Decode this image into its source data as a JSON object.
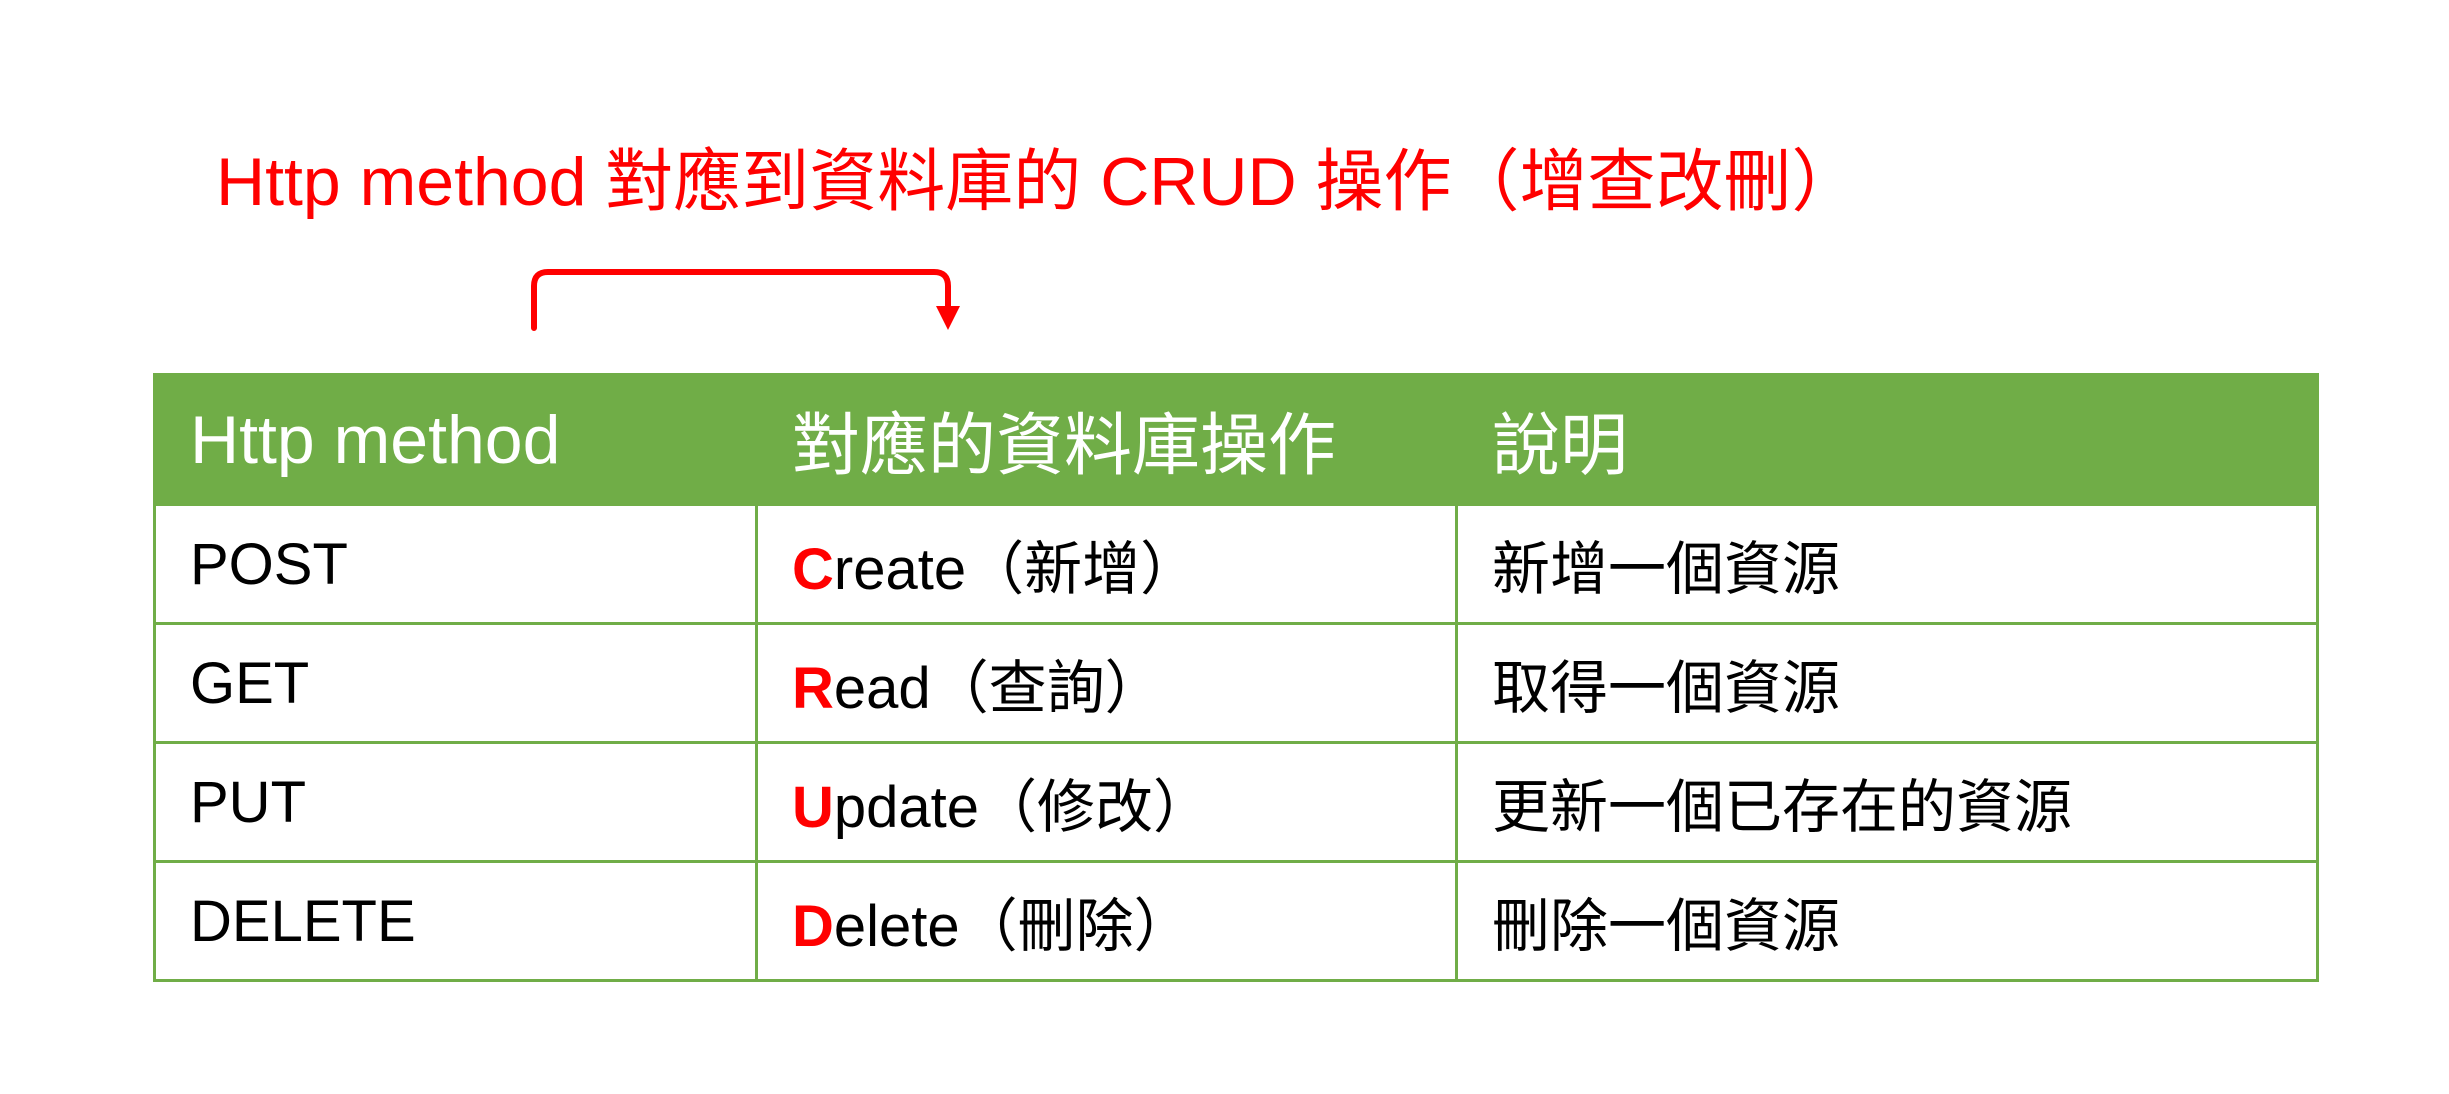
{
  "title": "Http method 對應到資料庫的 CRUD 操作（增查改刪）",
  "table": {
    "headers": {
      "method": "Http method",
      "operation": "對應的資料庫操作",
      "description": "說明"
    },
    "rows": [
      {
        "method": "POST",
        "op_initial": "C",
        "op_rest": "reate（新增）",
        "description": "新增一個資源"
      },
      {
        "method": "GET",
        "op_initial": "R",
        "op_rest": "ead（查詢）",
        "description": "取得一個資源"
      },
      {
        "method": "PUT",
        "op_initial": "U",
        "op_rest": "pdate（修改）",
        "description": "更新一個已存在的資源"
      },
      {
        "method": "DELETE",
        "op_initial": "D",
        "op_rest": "elete（刪除）",
        "description": "刪除一個資源"
      }
    ]
  },
  "colors": {
    "header_background": "#70ad47",
    "border": "#70ad47",
    "highlight": "#ff0000"
  }
}
